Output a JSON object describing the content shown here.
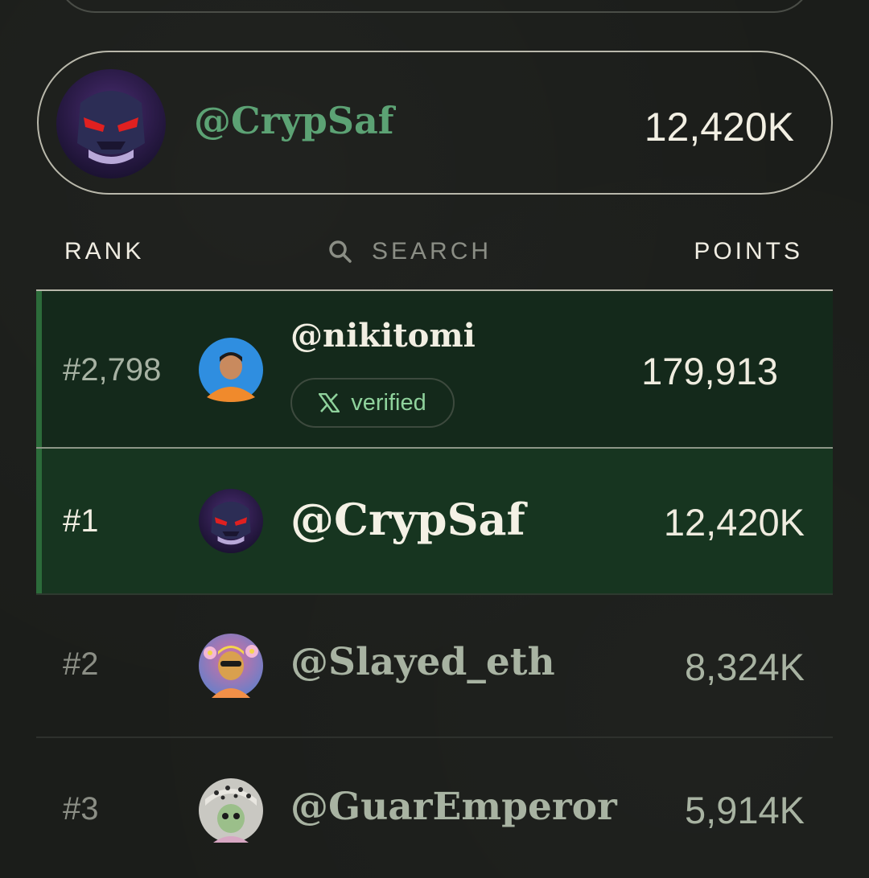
{
  "featured": {
    "handle": "@CrypSaf",
    "points": "12,420K",
    "avatar_icon": "villain-avatar-icon"
  },
  "header": {
    "rank_label": "RANK",
    "search_label": "SEARCH",
    "points_label": "POINTS"
  },
  "current_user": {
    "rank": "#2,798",
    "handle": "@nikitomi",
    "points": "179,913",
    "badge_label": "verified",
    "badge_icon": "x-logo-icon",
    "avatar_icon": "person-avatar-icon"
  },
  "leaderboard": [
    {
      "rank": "#1",
      "handle": "@CrypSaf",
      "points": "12,420K",
      "avatar_icon": "villain-avatar-icon"
    },
    {
      "rank": "#2",
      "handle": "@Slayed_eth",
      "points": "8,324K",
      "avatar_icon": "flower-ape-avatar-icon"
    },
    {
      "rank": "#3",
      "handle": "@GuarEmperor",
      "points": "5,914K",
      "avatar_icon": "leopard-hat-avatar-icon"
    }
  ],
  "colors": {
    "background": "#1b1d1a",
    "accent_green": "#5ca274",
    "highlight_row": "#173520",
    "current_row": "#14291b"
  }
}
